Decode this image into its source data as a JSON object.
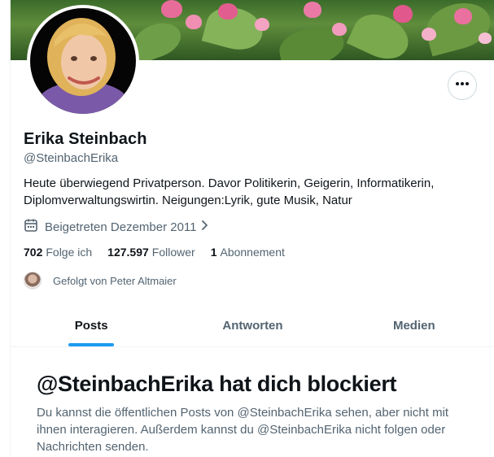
{
  "profile": {
    "name": "Erika Steinbach",
    "handle": "@SteinbachErika",
    "bio": "Heute überwiegend Privatperson. Davor Politikerin, Geigerin, Informatikerin, Diplomverwaltungswirtin. Neigungen:Lyrik, gute Musik, Natur",
    "joined": "Beigetreten Dezember 2011"
  },
  "stats": {
    "following_count": "702",
    "following_label": "Folge ich",
    "followers_count": "127.597",
    "followers_label": "Follower",
    "subscriptions_count": "1",
    "subscriptions_label": "Abonnement"
  },
  "followed_by": "Gefolgt von Peter Altmaier",
  "tabs": [
    {
      "label": "Posts",
      "active": true
    },
    {
      "label": "Antworten",
      "active": false
    },
    {
      "label": "Medien",
      "active": false
    }
  ],
  "blocked": {
    "title": "@SteinbachErika hat dich blockiert",
    "text": "Du kannst die öffentlichen Posts von @SteinbachErika sehen, aber nicht mit ihnen interagieren. Außerdem kannst du @SteinbachErika nicht folgen oder Nachrichten senden."
  },
  "icons": {
    "more": "more-horizontal-icon",
    "calendar": "calendar-icon",
    "chevron": "chevron-right-icon"
  },
  "colors": {
    "accent": "#1d9bf0",
    "text_primary": "#0f1419",
    "text_secondary": "#536471",
    "border": "#cfd9de"
  }
}
